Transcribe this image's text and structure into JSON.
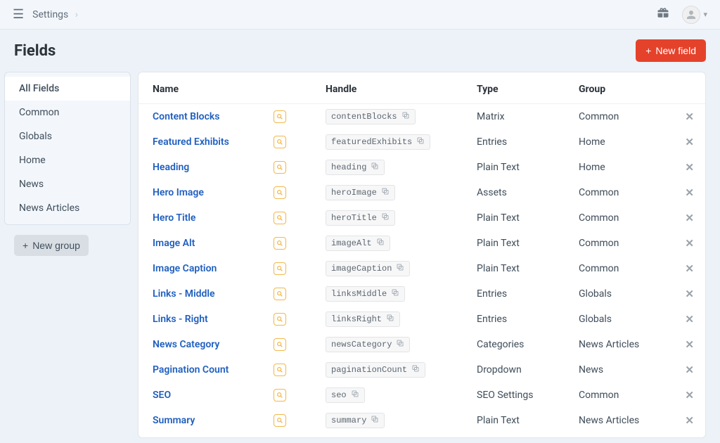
{
  "breadcrumb": {
    "label": "Settings"
  },
  "page": {
    "title": "Fields"
  },
  "actions": {
    "new_field": "New field",
    "new_group": "New group"
  },
  "sidebar": {
    "items": [
      {
        "label": "All Fields",
        "active": true
      },
      {
        "label": "Common",
        "active": false
      },
      {
        "label": "Globals",
        "active": false
      },
      {
        "label": "Home",
        "active": false
      },
      {
        "label": "News",
        "active": false
      },
      {
        "label": "News Articles",
        "active": false
      }
    ]
  },
  "table": {
    "columns": {
      "name": "Name",
      "handle": "Handle",
      "type": "Type",
      "group": "Group"
    },
    "rows": [
      {
        "name": "Content Blocks",
        "handle": "contentBlocks",
        "type": "Matrix",
        "group": "Common"
      },
      {
        "name": "Featured Exhibits",
        "handle": "featuredExhibits",
        "type": "Entries",
        "group": "Home"
      },
      {
        "name": "Heading",
        "handle": "heading",
        "type": "Plain Text",
        "group": "Home"
      },
      {
        "name": "Hero Image",
        "handle": "heroImage",
        "type": "Assets",
        "group": "Common"
      },
      {
        "name": "Hero Title",
        "handle": "heroTitle",
        "type": "Plain Text",
        "group": "Common"
      },
      {
        "name": "Image Alt",
        "handle": "imageAlt",
        "type": "Plain Text",
        "group": "Common"
      },
      {
        "name": "Image Caption",
        "handle": "imageCaption",
        "type": "Plain Text",
        "group": "Common"
      },
      {
        "name": "Links - Middle",
        "handle": "linksMiddle",
        "type": "Entries",
        "group": "Globals"
      },
      {
        "name": "Links - Right",
        "handle": "linksRight",
        "type": "Entries",
        "group": "Globals"
      },
      {
        "name": "News Category",
        "handle": "newsCategory",
        "type": "Categories",
        "group": "News Articles"
      },
      {
        "name": "Pagination Count",
        "handle": "paginationCount",
        "type": "Dropdown",
        "group": "News"
      },
      {
        "name": "SEO",
        "handle": "seo",
        "type": "SEO Settings",
        "group": "Common"
      },
      {
        "name": "Summary",
        "handle": "summary",
        "type": "Plain Text",
        "group": "News Articles"
      }
    ]
  }
}
